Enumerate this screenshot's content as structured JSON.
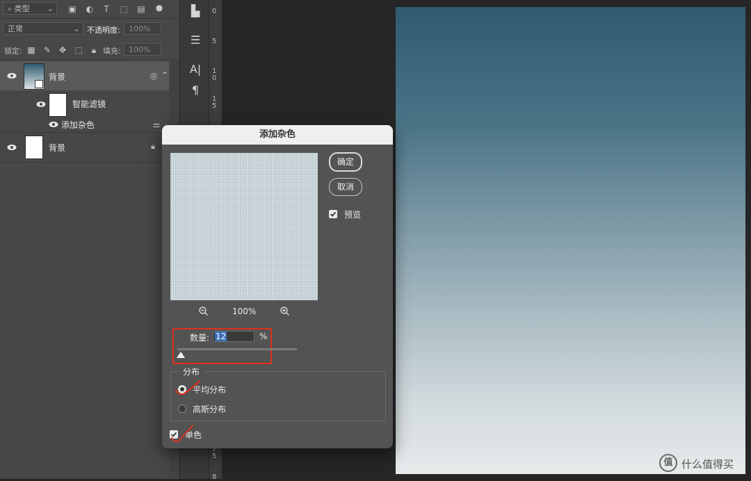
{
  "layers_panel": {
    "filter_label": "类型",
    "blend_mode": "正常",
    "opacity_label": "不透明度:",
    "opacity_value": "100%",
    "lock_label": "锁定:",
    "fill_label": "填充:",
    "fill_value": "100%",
    "layers": [
      {
        "name": "背景",
        "type": "smart-object"
      },
      {
        "name": "智能滤镜",
        "type": "smart-filter-mask"
      },
      {
        "name": "添加杂色",
        "type": "filter"
      },
      {
        "name": "背景",
        "type": "locked-background"
      }
    ]
  },
  "ruler": {
    "ticks": [
      "0",
      "5",
      "1\n0",
      "1\n5"
    ],
    "bottom_ticks": [
      "7\n5",
      "8"
    ]
  },
  "dialog": {
    "title": "添加杂色",
    "ok_label": "确定",
    "cancel_label": "取消",
    "preview_label": "预览",
    "preview_checked": true,
    "zoom_level": "100%",
    "amount_label": "数量:",
    "amount_value": "12",
    "amount_unit": "%",
    "amount_slider_fraction": 0.03,
    "distribution_label": "分布",
    "distribution_options": [
      "平均分布",
      "高斯分布"
    ],
    "distribution_selected": "平均分布",
    "monochromatic_label": "单色",
    "monochromatic_checked": true
  },
  "watermark": {
    "text": "什么值得买",
    "logo_text": "值"
  },
  "colors": {
    "highlight": "#e0301e",
    "input_selection": "#3a6fb6"
  }
}
